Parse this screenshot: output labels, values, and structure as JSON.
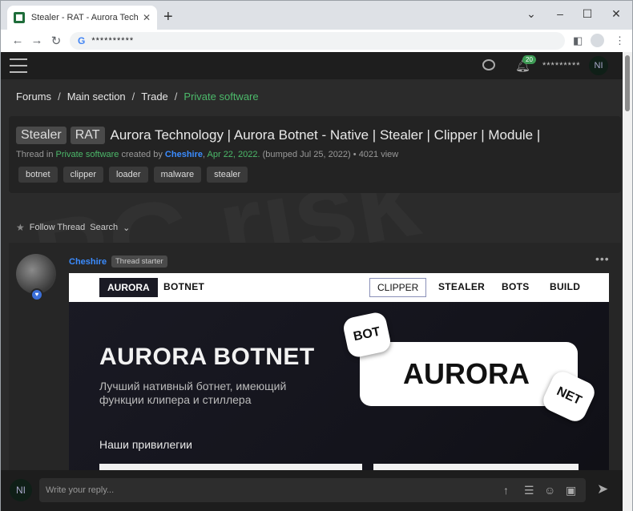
{
  "browser": {
    "tab_title": "Stealer - RAT - Aurora Technology",
    "url": "**********",
    "new_tab": "+",
    "minimize": "⌄",
    "min_btn": "–",
    "max_btn": "☐",
    "close_btn": "✕"
  },
  "topnav": {
    "notification_count": "20",
    "username": "*********",
    "avatar_initials": "NI"
  },
  "breadcrumb": [
    "Forums",
    "Main section",
    "Trade",
    "Private software"
  ],
  "thread": {
    "prefixes": [
      "Stealer",
      "RAT"
    ],
    "title": "Aurora Technology | Aurora Botnet - Native | Stealer | Clipper | Module |",
    "meta_prefix": "Thread in",
    "meta_forum": "Private software",
    "meta_created": "created by",
    "meta_author": "Cheshire",
    "meta_date": "Apr 22, 2022.",
    "meta_bumped": "(bumped Jul 25, 2022)",
    "meta_views": "• 4021 view",
    "tags": [
      "botnet",
      "clipper",
      "loader",
      "malware",
      "stealer"
    ]
  },
  "actions": {
    "follow": "Follow Thread",
    "search": "Search"
  },
  "post": {
    "author": "Cheshire",
    "badge": "Thread starter",
    "menu": "•••"
  },
  "banner": {
    "nav_aurora": "AURORA",
    "nav_botnet": "BOTNET",
    "nav_clipper": "CLIPPER",
    "nav_stealer": "STEALER",
    "nav_bots": "BOTS",
    "nav_build": "BUILD",
    "title": "AURORA BOTNET",
    "subtitle_line1": "Лучший нативный ботнет, имеющий",
    "subtitle_line2": "функции клипера и стиллера",
    "privileges": "Наши привилегии",
    "logo": "AURORA",
    "bot": "BOT",
    "net": "NET"
  },
  "reply": {
    "avatar_initials": "NI",
    "placeholder": "Write your reply..."
  }
}
